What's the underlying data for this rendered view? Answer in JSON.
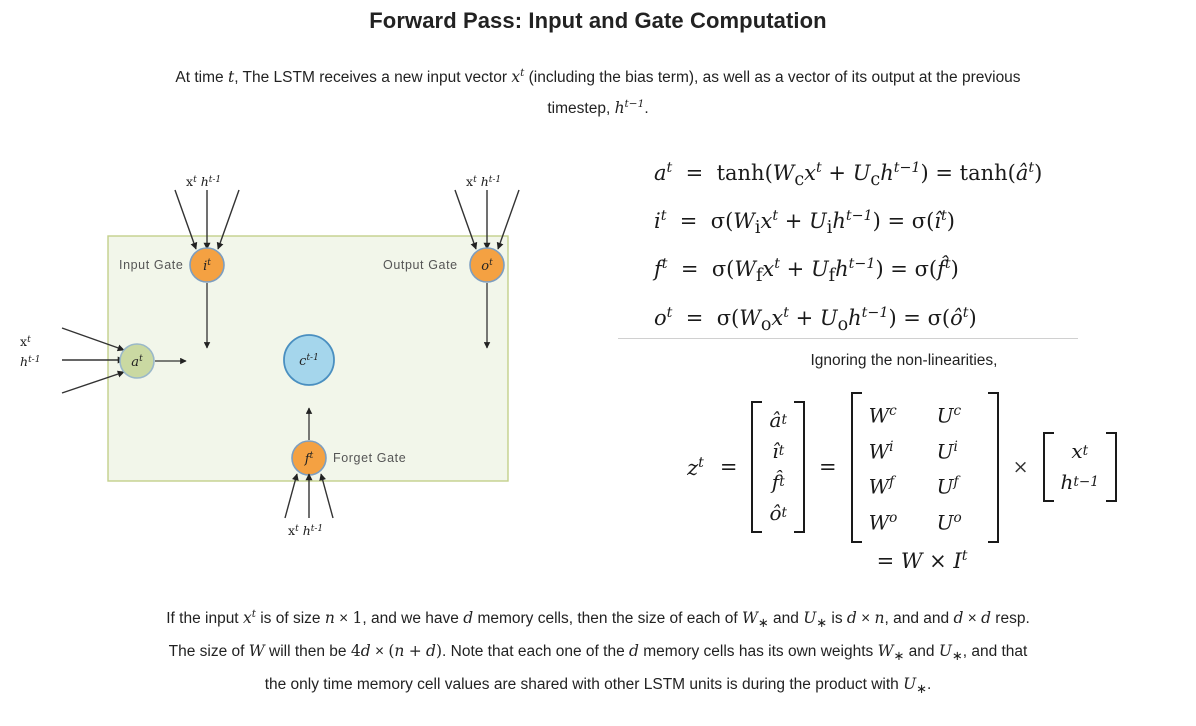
{
  "title": "Forward Pass: Input and Gate Computation",
  "intro": {
    "line1_a": "At time ",
    "line1_t": "t",
    "line1_b": ", The LSTM receives a new input vector ",
    "line1_x": "x",
    "line1_xsup": "t",
    "line1_c": " (including the bias term), as well as a vector of its output at the previous",
    "line2_a": "timestep, ",
    "line2_h": "h",
    "line2_hsup": "t−1",
    "line2_b": "."
  },
  "diagram": {
    "cell_box_label": "lstm-cell-box",
    "colors": {
      "box_fill": "#f2f6ea",
      "box_stroke": "#c3d08b",
      "gate_fill": "#f5a council",
      "gate_orange": "#f6a councilxx"
    },
    "nodes": [
      {
        "id": "input-gate",
        "base": "i",
        "sup": "t",
        "gate_label": "Input Gate",
        "fill": "#f4a142",
        "stroke": "#7d9ec0"
      },
      {
        "id": "output-gate",
        "base": "o",
        "sup": "t",
        "gate_label": "Output Gate",
        "fill": "#f4a142",
        "stroke": "#7d9ec0"
      },
      {
        "id": "forget-gate",
        "base": "f",
        "sup": "t",
        "gate_label": "Forget Gate",
        "fill": "#f4a142",
        "stroke": "#7d9ec0"
      },
      {
        "id": "activation",
        "base": "a",
        "sup": "t",
        "gate_label": "",
        "fill": "#cad9a2",
        "stroke": "#9ab8c9"
      },
      {
        "id": "cell-state",
        "base": "c",
        "sup": "t-1",
        "gate_label": "",
        "fill": "#a5d6ec",
        "stroke": "#4a8fc0"
      }
    ],
    "labels": {
      "input_top_x": "x",
      "input_top_x_sup": "t",
      "input_top_h": "h",
      "input_top_h_sup": "t-1",
      "output_top_x": "x",
      "output_top_x_sup": "t",
      "output_top_h": "h",
      "output_top_h_sup": "t-1",
      "forget_bottom_x": "x",
      "forget_bottom_x_sup": "t",
      "forget_bottom_h": "h",
      "forget_bottom_h_sup": "t-1",
      "left_x": "x",
      "left_x_sup": "t",
      "left_h": "h",
      "left_h_sup": "t-1",
      "input_gate_text": "Input Gate",
      "output_gate_text": "Output Gate",
      "forget_gate_text": "Forget Gate"
    }
  },
  "equations": {
    "rows": [
      {
        "lhs_base": "a",
        "lhs_sup": "t",
        "fn": "tanh",
        "W": "W",
        "Wsub": "c",
        "U": "U",
        "Usub": "c",
        "rhs_fn": "tanh",
        "rhs_base": "a",
        "rhs_hat": true,
        "rhs_sup": "t"
      },
      {
        "lhs_base": "i",
        "lhs_sup": "t",
        "fn": "σ",
        "W": "W",
        "Wsub": "i",
        "U": "U",
        "Usub": "i",
        "rhs_fn": "σ",
        "rhs_base": "i",
        "rhs_hat": true,
        "rhs_sup": "t"
      },
      {
        "lhs_base": "f",
        "lhs_sup": "t",
        "fn": "σ",
        "W": "W",
        "Wsub": "f",
        "U": "U",
        "Usub": "f",
        "rhs_fn": "σ",
        "rhs_base": "f",
        "rhs_hat": true,
        "rhs_sup": "t"
      },
      {
        "lhs_base": "o",
        "lhs_sup": "t",
        "fn": "σ",
        "W": "W",
        "Wsub": "o",
        "U": "U",
        "Usub": "o",
        "rhs_fn": "σ",
        "rhs_base": "o",
        "rhs_hat": true,
        "rhs_sup": "t"
      }
    ]
  },
  "ignoring_text": "Ignoring the non-linearities,",
  "matrix": {
    "z_label": "z",
    "z_sup": "t",
    "eq1": "=",
    "eq2": "=",
    "times": "×",
    "z_vector": [
      "â",
      "î",
      "f̂",
      "ô"
    ],
    "z_vector_sup": [
      "t",
      "t",
      "t",
      "t"
    ],
    "weights": [
      [
        "W",
        "c",
        "U",
        "c"
      ],
      [
        "W",
        "i",
        "U",
        "i"
      ],
      [
        "W",
        "f",
        "U",
        "f"
      ],
      [
        "W",
        "o",
        "U",
        "o"
      ]
    ],
    "input_vector": [
      {
        "base": "x",
        "sup": "t"
      },
      {
        "base": "h",
        "sup": "t−1"
      }
    ],
    "final_line": {
      "eq": "=",
      "W": "W",
      "times": "×",
      "I": "I",
      "I_sup": "t"
    }
  },
  "footer": {
    "l1_a": "If the input ",
    "l1_x": "x",
    "l1_xsup": "t",
    "l1_b": " is of size ",
    "l1_n": "n",
    "l1_times": " × ",
    "l1_one": "1",
    "l1_c": ", and we have ",
    "l1_d": "d",
    "l1_e": " memory cells, then the size of each of ",
    "l1_W": "W",
    "l1_Wsub": "∗",
    "l1_f": " and ",
    "l1_U": "U",
    "l1_Usub": "∗",
    "l1_g": " is ",
    "l1_d2": "d",
    "l1_times2": " × ",
    "l1_n2": "n",
    "l1_h": ", and and ",
    "l1_d3": "d",
    "l1_times3": " × ",
    "l1_d4": "d",
    "l1_i": " resp.",
    "l2_a": "The size of ",
    "l2_W": "W",
    "l2_b": " will then be ",
    "l2_4d": "4d",
    "l2_times": " × ",
    "l2_nd": "(n + d)",
    "l2_c": ". Note that each one of the ",
    "l2_d": "d",
    "l2_e": " memory cells has its own weights ",
    "l2_W2": "W",
    "l2_W2sub": "∗",
    "l2_f": " and ",
    "l2_U": "U",
    "l2_Usub": "∗",
    "l2_g": ", and that",
    "l3_a": "the only time memory cell values are shared with other LSTM units is during the product with ",
    "l3_U": "U",
    "l3_Usub": "∗",
    "l3_b": "."
  }
}
